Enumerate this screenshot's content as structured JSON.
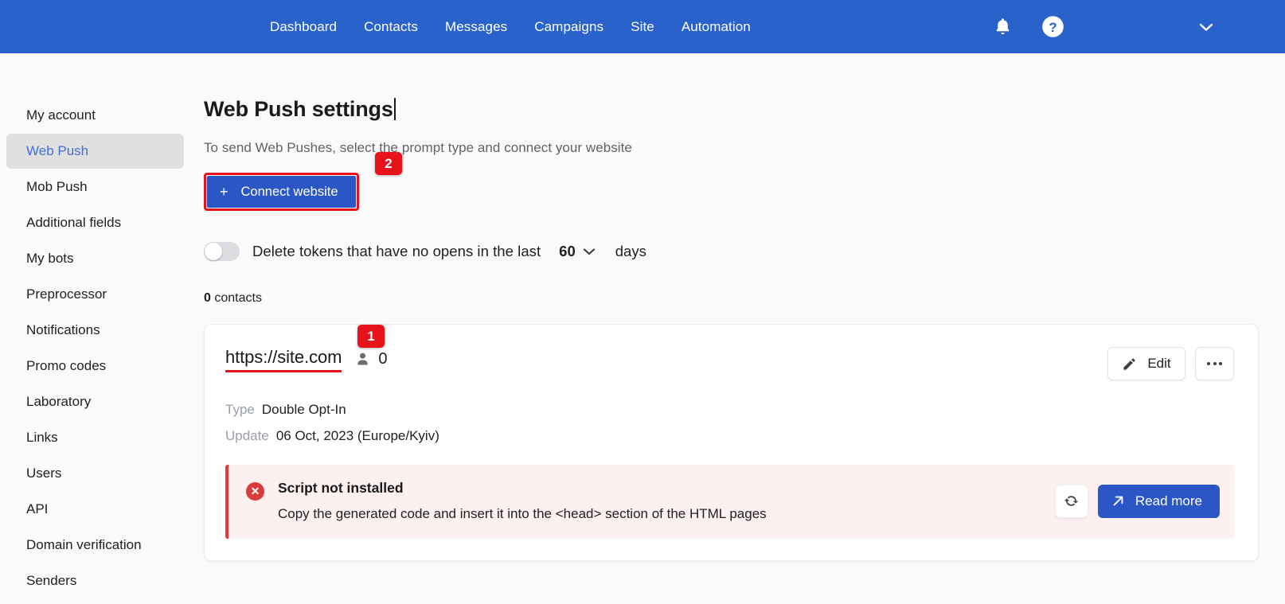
{
  "topnav": {
    "links": [
      {
        "label": "Dashboard"
      },
      {
        "label": "Contacts"
      },
      {
        "label": "Messages"
      },
      {
        "label": "Campaigns"
      },
      {
        "label": "Site"
      },
      {
        "label": "Automation"
      }
    ],
    "icons": {
      "notifications": "bell-icon",
      "help": "help-circle-icon",
      "account_menu": "chevron-down-icon"
    },
    "background_color": "#2a62cc"
  },
  "sidebar": {
    "items": [
      {
        "label": "My account",
        "active": false
      },
      {
        "label": "Web Push",
        "active": true
      },
      {
        "label": "Mob Push",
        "active": false
      },
      {
        "label": "Additional fields",
        "active": false
      },
      {
        "label": "My bots",
        "active": false
      },
      {
        "label": "Preprocessor",
        "active": false
      },
      {
        "label": "Notifications",
        "active": false
      },
      {
        "label": "Promo codes",
        "active": false
      },
      {
        "label": "Laboratory",
        "active": false
      },
      {
        "label": "Links",
        "active": false
      },
      {
        "label": "Users",
        "active": false
      },
      {
        "label": "API",
        "active": false
      },
      {
        "label": "Domain verification",
        "active": false
      },
      {
        "label": "Senders",
        "active": false
      }
    ],
    "active_color": "#3f6fd8",
    "active_background": "#e0e0e0"
  },
  "main": {
    "title": "Web Push settings",
    "subtitle": "To send Web Pushes, select the prompt type and connect your website",
    "connect_button": {
      "label": "Connect website",
      "plus": "+",
      "color": "#2a56c6"
    },
    "annotations": [
      {
        "number": "1",
        "color": "#e8131a",
        "target": "site-url"
      },
      {
        "number": "2",
        "color": "#e8131a",
        "target": "connect-website-button"
      }
    ],
    "delete_tokens": {
      "label": "Delete tokens that have no opens in the last",
      "days_value": "60",
      "days_unit": "days",
      "enabled": false
    },
    "contacts": {
      "count": "0",
      "label": "contacts"
    }
  },
  "site_card": {
    "url": "https://site.com",
    "subscriber_count": "0",
    "subscriber_icon": "person-icon",
    "edit_button": "Edit",
    "more_button": "more-options-icon",
    "meta": [
      {
        "key": "Type",
        "value": "Double Opt-In"
      },
      {
        "key": "Update",
        "value": "06 Oct, 2023 (Europe/Kyiv)"
      }
    ],
    "alert": {
      "icon": "error-circle-icon",
      "title": "Script not installed",
      "text": "Copy the generated code and insert it into the <head> section of the HTML pages",
      "refresh_icon": "refresh-icon",
      "read_more_label": "Read more",
      "read_more_icon": "external-link-arrow-icon",
      "accent_color": "#e53935",
      "background_color": "#fdf0f0"
    }
  }
}
